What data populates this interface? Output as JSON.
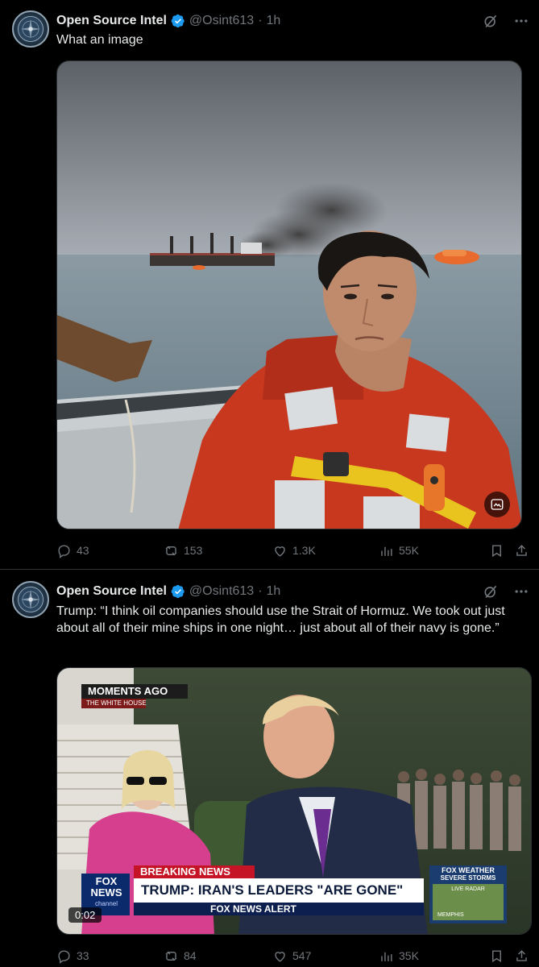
{
  "posts": [
    {
      "author": "Open Source Intel",
      "handle": "@Osint613",
      "separator": "·",
      "time": "1h",
      "text": "What an image",
      "media_type": "photo",
      "stats": {
        "replies": "43",
        "reposts": "153",
        "likes": "1.3K",
        "views": "55K"
      }
    },
    {
      "author": "Open Source Intel",
      "handle": "@Osint613",
      "separator": "·",
      "time": "1h",
      "text": "Trump: “I think oil companies should use the Strait of Hormuz. We took out just about all of their mine ships in one night… just about all of their navy is gone.”",
      "media_type": "video",
      "video_time": "0:02",
      "video_overlay": {
        "bug_top": "MOMENTS AGO",
        "bug_bottom": "THE WHITE HOUSE",
        "breaking": "BREAKING NEWS",
        "headline": "TRUMP: IRAN'S LEADERS \"ARE GONE\"",
        "alert": "FOX NEWS ALERT",
        "logo_top": "FOX",
        "logo_bottom": "NEWS",
        "logo_small": "channel",
        "weather_title": "FOX WEATHER",
        "weather_line": "SEVERE STORMS",
        "weather_sub": "LIVE RADAR",
        "weather_city": "MEMPHIS"
      },
      "stats": {
        "replies": "33",
        "reposts": "84",
        "likes": "547",
        "views": "35K"
      }
    }
  ],
  "colors": {
    "background": "#000000",
    "text": "#e7e9ea",
    "muted": "#71767b",
    "verified": "#1d9bf0",
    "divider": "#2f3336"
  },
  "icons": [
    "verified-badge-icon",
    "grok-icon",
    "more-icon",
    "reply-icon",
    "repost-icon",
    "like-icon",
    "views-icon",
    "bookmark-icon",
    "share-icon",
    "edit-image-icon"
  ]
}
